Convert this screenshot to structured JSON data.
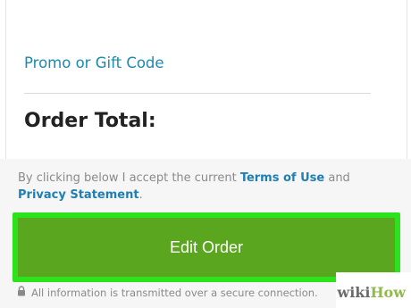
{
  "summary": {
    "promo_link": "Promo or Gift Code",
    "order_total_label": "Order Total:"
  },
  "terms": {
    "prefix": "By clicking below I accept the current ",
    "terms_link": "Terms of Use",
    "middle": " and ",
    "privacy_link": "Privacy Statement",
    "suffix": "."
  },
  "actions": {
    "edit_order_label": "Edit Order"
  },
  "security": {
    "icon": "lock-icon",
    "text": "All information is transmitted over a secure connection."
  },
  "watermark": {
    "part1": "wiki",
    "part2": "How"
  },
  "colors": {
    "link": "#1a8ab0",
    "button": "#5aa61f",
    "highlight": "#2ce21a"
  }
}
